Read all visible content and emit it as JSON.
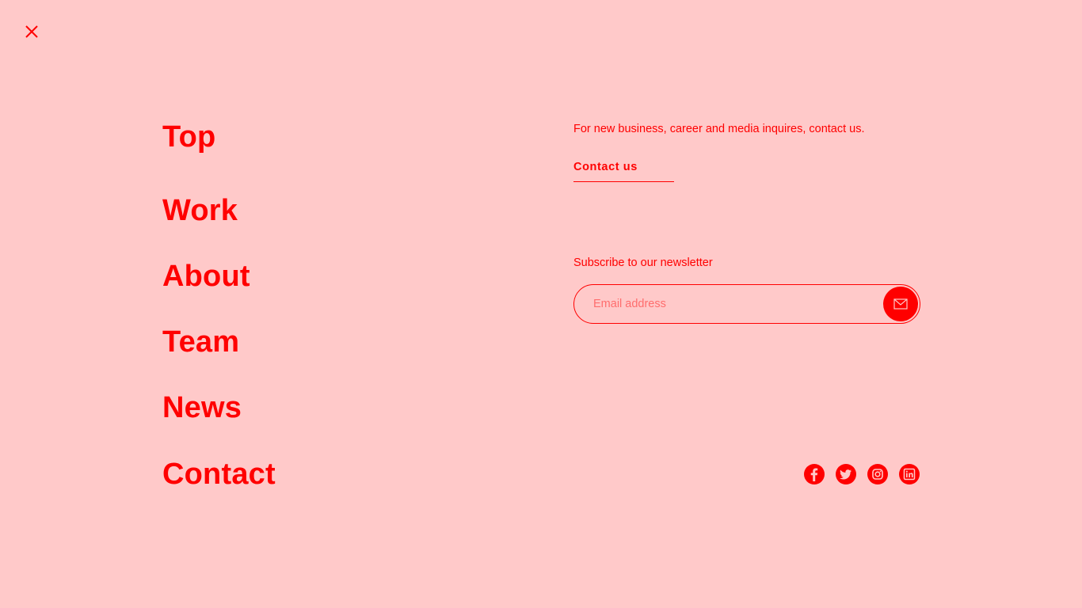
{
  "close_icon": "close-icon",
  "nav": {
    "items": [
      {
        "label": "Top"
      },
      {
        "label": "Work"
      },
      {
        "label": "About"
      },
      {
        "label": "Team"
      },
      {
        "label": "News"
      },
      {
        "label": "Contact"
      }
    ]
  },
  "contact": {
    "blurb": "For new business, career and media inquires, contact us.",
    "link_label": "Contact us"
  },
  "newsletter": {
    "label": "Subscribe to our newsletter",
    "placeholder": "Email address",
    "submit_icon": "mail-icon"
  },
  "social": [
    {
      "icon": "facebook-icon"
    },
    {
      "icon": "twitter-icon"
    },
    {
      "icon": "instagram-icon"
    },
    {
      "icon": "linkedin-icon"
    }
  ],
  "colors": {
    "background": "#ffc9c9",
    "accent": "#ff0000",
    "placeholder": "#ff6d6d"
  }
}
